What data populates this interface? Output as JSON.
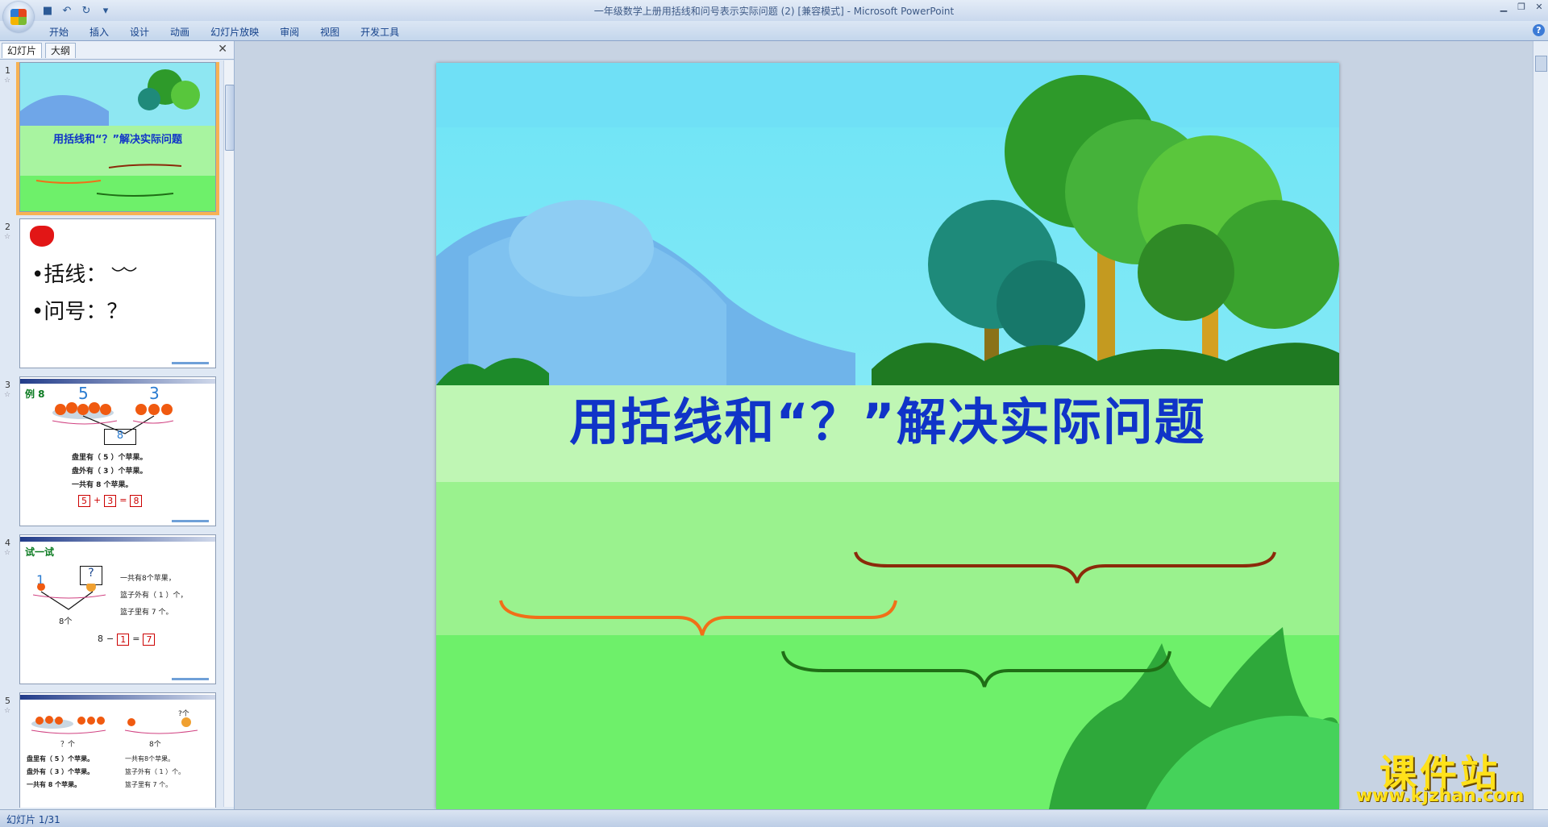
{
  "window": {
    "title": "一年级数学上册用括线和问号表示实际问题 (2) [兼容模式] - Microsoft PowerPoint"
  },
  "quick_access": [
    {
      "icon": "save-icon",
      "glyph": "■"
    },
    {
      "icon": "undo-icon",
      "glyph": "↶"
    },
    {
      "icon": "redo-icon",
      "glyph": "↻"
    },
    {
      "icon": "customize-icon",
      "glyph": "▾"
    }
  ],
  "ribbon": {
    "tabs": [
      "开始",
      "插入",
      "设计",
      "动画",
      "幻灯片放映",
      "审阅",
      "视图",
      "开发工具"
    ]
  },
  "left_pane": {
    "tabs": [
      "幻灯片",
      "大纲"
    ],
    "close_glyph": "✕"
  },
  "thumbnails": [
    {
      "number": "1",
      "title": "用括线和“？”解决实际问题"
    },
    {
      "number": "2",
      "lines": [
        "•括线：",
        "•问号：？"
      ]
    },
    {
      "number": "3",
      "heading": "例 8",
      "lines": [
        "盘里有（ 5 ）个苹果。",
        "盘外有（ 3 ）个苹果。",
        "一共有  8  个苹果。"
      ],
      "equation": [
        "5",
        "+",
        "3",
        "=",
        "8"
      ],
      "top_numbers": [
        "5",
        "3"
      ],
      "box_number": "8"
    },
    {
      "number": "4",
      "heading": "试一试",
      "lines": [
        "一共有8个苹果，",
        "篮子外有（ 1 ）个，",
        "篮子里有  7  个。"
      ],
      "equation": [
        "8",
        "−",
        "1",
        "=",
        "7"
      ],
      "side_label": "8个",
      "left_num": "1",
      "box_label": "?"
    },
    {
      "number": "5",
      "lines": [
        "盘里有（ 5 ）个苹果。",
        "盘外有（ 3 ）个苹果。",
        "一共有  8  个苹果。"
      ],
      "right_lines": [
        "一共有8个苹果。",
        "篮子外有（ 1 ）个。",
        "篮子里有  7  个。"
      ],
      "labels": [
        "？个",
        "8个",
        "?个"
      ]
    }
  ],
  "slide": {
    "title": "用括线和“？”解决实际问题",
    "title_color": "#1034c8",
    "brace_colors": [
      "#8b2a0a",
      "#f07018",
      "#1f6e16"
    ]
  },
  "status_bar": {
    "slide_info": "幻灯片 1/31"
  },
  "watermark": {
    "text": "课件站",
    "url": "www.kjzhan.com"
  }
}
